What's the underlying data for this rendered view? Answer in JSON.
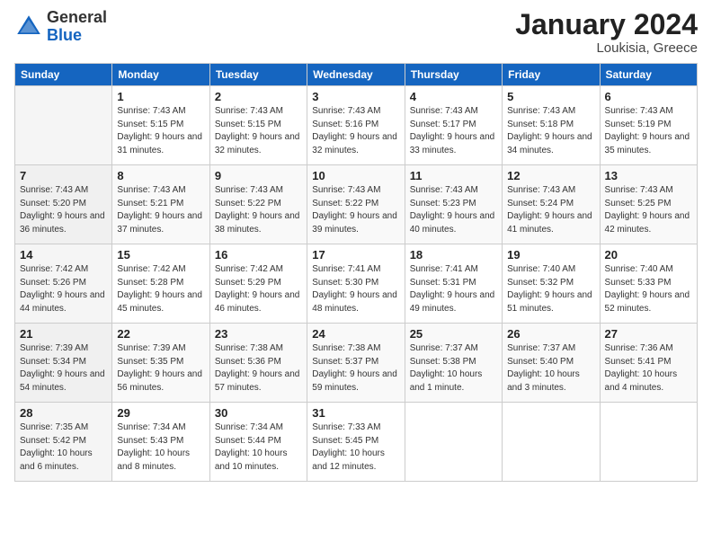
{
  "logo": {
    "line1": "General",
    "line2": "Blue"
  },
  "header": {
    "month": "January 2024",
    "location": "Loukisia, Greece"
  },
  "weekdays": [
    "Sunday",
    "Monday",
    "Tuesday",
    "Wednesday",
    "Thursday",
    "Friday",
    "Saturday"
  ],
  "weeks": [
    [
      {
        "day": "",
        "sunrise": "",
        "sunset": "",
        "daylight": ""
      },
      {
        "day": "1",
        "sunrise": "Sunrise: 7:43 AM",
        "sunset": "Sunset: 5:15 PM",
        "daylight": "Daylight: 9 hours and 31 minutes."
      },
      {
        "day": "2",
        "sunrise": "Sunrise: 7:43 AM",
        "sunset": "Sunset: 5:15 PM",
        "daylight": "Daylight: 9 hours and 32 minutes."
      },
      {
        "day": "3",
        "sunrise": "Sunrise: 7:43 AM",
        "sunset": "Sunset: 5:16 PM",
        "daylight": "Daylight: 9 hours and 32 minutes."
      },
      {
        "day": "4",
        "sunrise": "Sunrise: 7:43 AM",
        "sunset": "Sunset: 5:17 PM",
        "daylight": "Daylight: 9 hours and 33 minutes."
      },
      {
        "day": "5",
        "sunrise": "Sunrise: 7:43 AM",
        "sunset": "Sunset: 5:18 PM",
        "daylight": "Daylight: 9 hours and 34 minutes."
      },
      {
        "day": "6",
        "sunrise": "Sunrise: 7:43 AM",
        "sunset": "Sunset: 5:19 PM",
        "daylight": "Daylight: 9 hours and 35 minutes."
      }
    ],
    [
      {
        "day": "7",
        "sunrise": "Sunrise: 7:43 AM",
        "sunset": "Sunset: 5:20 PM",
        "daylight": "Daylight: 9 hours and 36 minutes."
      },
      {
        "day": "8",
        "sunrise": "Sunrise: 7:43 AM",
        "sunset": "Sunset: 5:21 PM",
        "daylight": "Daylight: 9 hours and 37 minutes."
      },
      {
        "day": "9",
        "sunrise": "Sunrise: 7:43 AM",
        "sunset": "Sunset: 5:22 PM",
        "daylight": "Daylight: 9 hours and 38 minutes."
      },
      {
        "day": "10",
        "sunrise": "Sunrise: 7:43 AM",
        "sunset": "Sunset: 5:22 PM",
        "daylight": "Daylight: 9 hours and 39 minutes."
      },
      {
        "day": "11",
        "sunrise": "Sunrise: 7:43 AM",
        "sunset": "Sunset: 5:23 PM",
        "daylight": "Daylight: 9 hours and 40 minutes."
      },
      {
        "day": "12",
        "sunrise": "Sunrise: 7:43 AM",
        "sunset": "Sunset: 5:24 PM",
        "daylight": "Daylight: 9 hours and 41 minutes."
      },
      {
        "day": "13",
        "sunrise": "Sunrise: 7:43 AM",
        "sunset": "Sunset: 5:25 PM",
        "daylight": "Daylight: 9 hours and 42 minutes."
      }
    ],
    [
      {
        "day": "14",
        "sunrise": "Sunrise: 7:42 AM",
        "sunset": "Sunset: 5:26 PM",
        "daylight": "Daylight: 9 hours and 44 minutes."
      },
      {
        "day": "15",
        "sunrise": "Sunrise: 7:42 AM",
        "sunset": "Sunset: 5:28 PM",
        "daylight": "Daylight: 9 hours and 45 minutes."
      },
      {
        "day": "16",
        "sunrise": "Sunrise: 7:42 AM",
        "sunset": "Sunset: 5:29 PM",
        "daylight": "Daylight: 9 hours and 46 minutes."
      },
      {
        "day": "17",
        "sunrise": "Sunrise: 7:41 AM",
        "sunset": "Sunset: 5:30 PM",
        "daylight": "Daylight: 9 hours and 48 minutes."
      },
      {
        "day": "18",
        "sunrise": "Sunrise: 7:41 AM",
        "sunset": "Sunset: 5:31 PM",
        "daylight": "Daylight: 9 hours and 49 minutes."
      },
      {
        "day": "19",
        "sunrise": "Sunrise: 7:40 AM",
        "sunset": "Sunset: 5:32 PM",
        "daylight": "Daylight: 9 hours and 51 minutes."
      },
      {
        "day": "20",
        "sunrise": "Sunrise: 7:40 AM",
        "sunset": "Sunset: 5:33 PM",
        "daylight": "Daylight: 9 hours and 52 minutes."
      }
    ],
    [
      {
        "day": "21",
        "sunrise": "Sunrise: 7:39 AM",
        "sunset": "Sunset: 5:34 PM",
        "daylight": "Daylight: 9 hours and 54 minutes."
      },
      {
        "day": "22",
        "sunrise": "Sunrise: 7:39 AM",
        "sunset": "Sunset: 5:35 PM",
        "daylight": "Daylight: 9 hours and 56 minutes."
      },
      {
        "day": "23",
        "sunrise": "Sunrise: 7:38 AM",
        "sunset": "Sunset: 5:36 PM",
        "daylight": "Daylight: 9 hours and 57 minutes."
      },
      {
        "day": "24",
        "sunrise": "Sunrise: 7:38 AM",
        "sunset": "Sunset: 5:37 PM",
        "daylight": "Daylight: 9 hours and 59 minutes."
      },
      {
        "day": "25",
        "sunrise": "Sunrise: 7:37 AM",
        "sunset": "Sunset: 5:38 PM",
        "daylight": "Daylight: 10 hours and 1 minute."
      },
      {
        "day": "26",
        "sunrise": "Sunrise: 7:37 AM",
        "sunset": "Sunset: 5:40 PM",
        "daylight": "Daylight: 10 hours and 3 minutes."
      },
      {
        "day": "27",
        "sunrise": "Sunrise: 7:36 AM",
        "sunset": "Sunset: 5:41 PM",
        "daylight": "Daylight: 10 hours and 4 minutes."
      }
    ],
    [
      {
        "day": "28",
        "sunrise": "Sunrise: 7:35 AM",
        "sunset": "Sunset: 5:42 PM",
        "daylight": "Daylight: 10 hours and 6 minutes."
      },
      {
        "day": "29",
        "sunrise": "Sunrise: 7:34 AM",
        "sunset": "Sunset: 5:43 PM",
        "daylight": "Daylight: 10 hours and 8 minutes."
      },
      {
        "day": "30",
        "sunrise": "Sunrise: 7:34 AM",
        "sunset": "Sunset: 5:44 PM",
        "daylight": "Daylight: 10 hours and 10 minutes."
      },
      {
        "day": "31",
        "sunrise": "Sunrise: 7:33 AM",
        "sunset": "Sunset: 5:45 PM",
        "daylight": "Daylight: 10 hours and 12 minutes."
      },
      {
        "day": "",
        "sunrise": "",
        "sunset": "",
        "daylight": ""
      },
      {
        "day": "",
        "sunrise": "",
        "sunset": "",
        "daylight": ""
      },
      {
        "day": "",
        "sunrise": "",
        "sunset": "",
        "daylight": ""
      }
    ]
  ]
}
